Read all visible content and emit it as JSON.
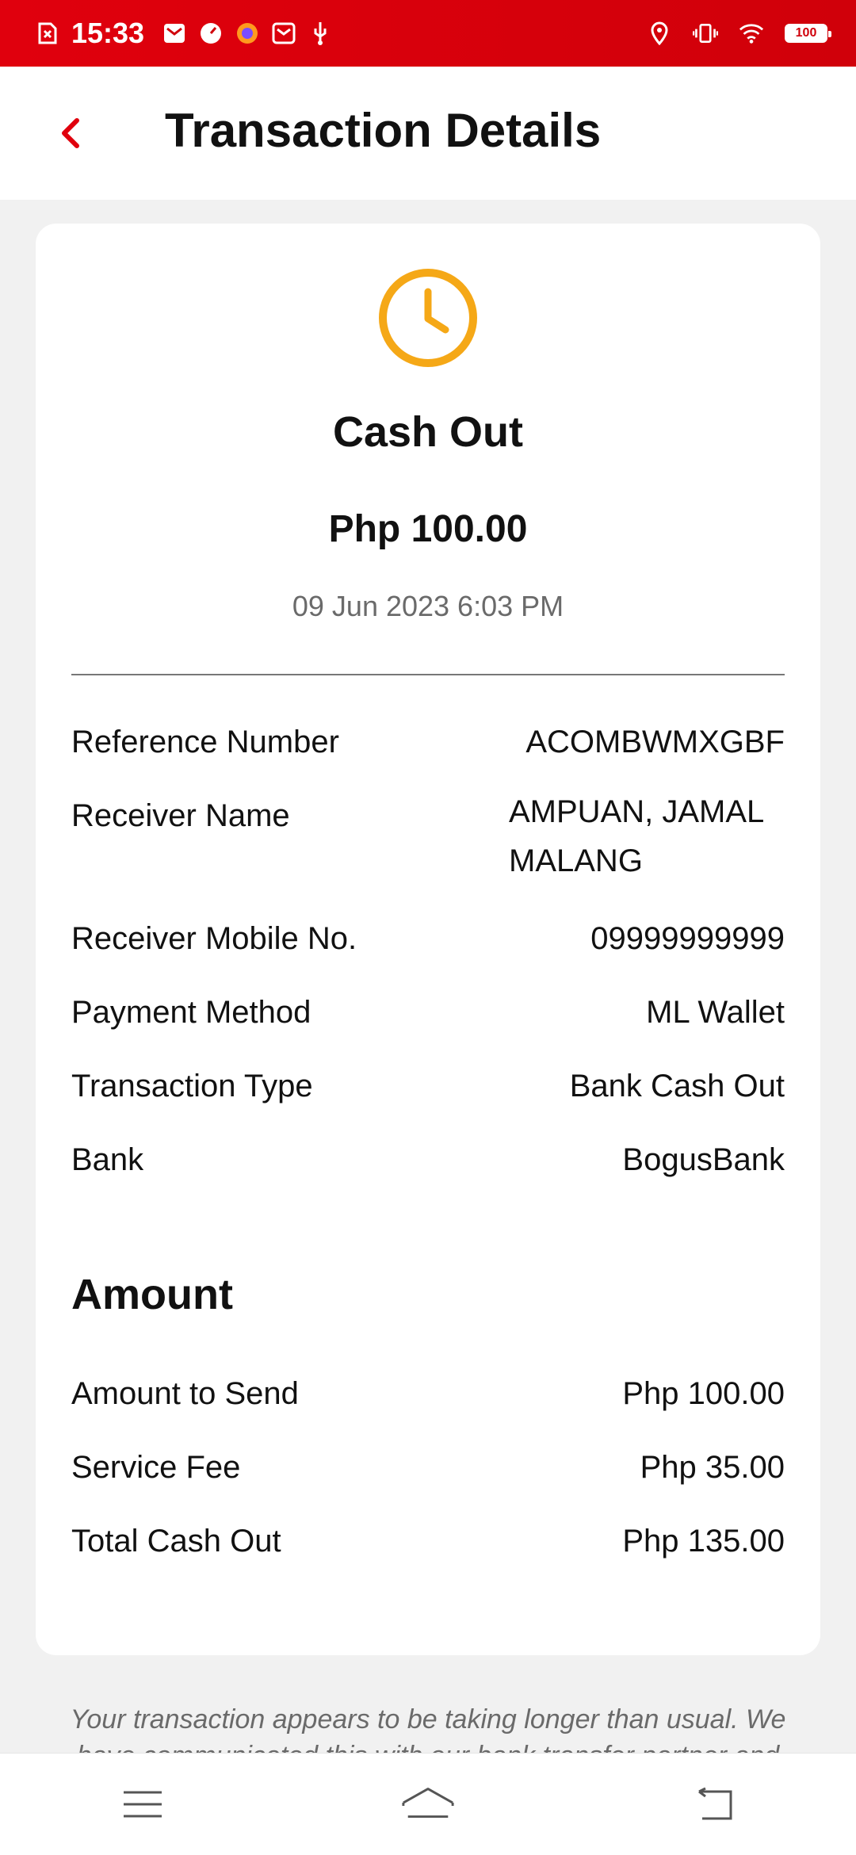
{
  "status_bar": {
    "time": "15:33",
    "battery": "100"
  },
  "header": {
    "title": "Transaction Details"
  },
  "transaction": {
    "type": "Cash Out",
    "amount": "Php 100.00",
    "datetime": "09 Jun 2023 6:03 PM",
    "status_color": "#f5a817"
  },
  "details": [
    {
      "label": "Reference Number",
      "value": "ACOMBWMXGBF"
    },
    {
      "label": "Receiver Name",
      "value": "AMPUAN, JAMAL MALANG"
    },
    {
      "label": "Receiver Mobile No.",
      "value": "09999999999"
    },
    {
      "label": "Payment Method",
      "value": "ML Wallet"
    },
    {
      "label": "Transaction Type",
      "value": "Bank Cash Out"
    },
    {
      "label": "Bank",
      "value": "BogusBank"
    }
  ],
  "amount_section": {
    "title": "Amount",
    "rows": [
      {
        "label": "Amount to Send",
        "value": "Php 100.00"
      },
      {
        "label": "Service Fee",
        "value": "Php 35.00"
      },
      {
        "label": "Total Cash Out",
        "value": "Php 135.00"
      }
    ]
  },
  "note": "Your transaction appears to be taking longer than usual. We have communicated this with our bank transfer partner and",
  "nav": {
    "icons": [
      "menu-icon",
      "home-icon",
      "back-icon"
    ]
  },
  "colors": {
    "brand_red": "#e0000d",
    "status_pending": "#f5a817"
  }
}
